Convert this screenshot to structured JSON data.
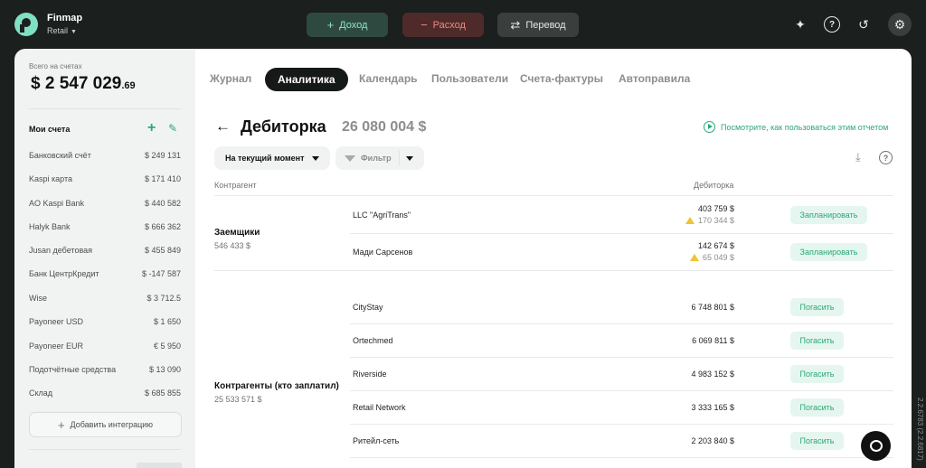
{
  "app": {
    "brand": "Finmap",
    "workspace": "Retail"
  },
  "topbar": {
    "income_label": "Доход",
    "expense_label": "Расход",
    "transfer_label": "Перевод"
  },
  "sidebar": {
    "total_label": "Всего на счетах",
    "total_main": "$ 2 547 029",
    "total_cents": ".69",
    "accounts_title": "Мои счета",
    "accounts": [
      {
        "name": "Банковский счёт",
        "value": "$ 249 131"
      },
      {
        "name": "Kaspi карта",
        "value": "$ 171 410"
      },
      {
        "name": "AO Kaspi Bank",
        "value": "$ 440 582"
      },
      {
        "name": "Halyk Bank",
        "value": "$ 666 362"
      },
      {
        "name": "Jusan дебетовая",
        "value": "$ 455 849"
      },
      {
        "name": "Банк ЦентрКредит",
        "value": "$ -147 587"
      },
      {
        "name": "Wise",
        "value": "$ 3 712.5"
      },
      {
        "name": "Payoneer USD",
        "value": "$ 1 650"
      },
      {
        "name": "Payoneer EUR",
        "value": "€ 5 950"
      },
      {
        "name": "Подотчётные средства",
        "value": "$ 13 090"
      },
      {
        "name": "Склад",
        "value": "$ 685 855"
      }
    ],
    "integration_label": "Добавить интеграцию"
  },
  "tabs": [
    "Журнал",
    "Аналитика",
    "Календарь",
    "Пользователи",
    "Счета-фактуры",
    "Автоправила"
  ],
  "report": {
    "title": "Дебиторка",
    "total": "26 080 004  $",
    "howto_label": "Посмотрите, как пользоваться этим отчетом",
    "period_label": "На текущий момент",
    "filter_label": "Фильтр",
    "col_counterparty": "Контрагент",
    "col_receivable": "Дебиторка",
    "groups": [
      {
        "name": "Заемщики",
        "sum": "546 433  $",
        "rows": [
          {
            "name": "LLC \"AgriTrans\"",
            "amount": "403 759  $",
            "overdue": "170 344  $",
            "action": "Запланировать"
          },
          {
            "name": "Мади Сарсенов",
            "amount": "142 674  $",
            "overdue": "65 049  $",
            "action": "Запланировать"
          }
        ]
      },
      {
        "name": "Контрагенты (кто заплатил)",
        "sum": "25 533 571  $",
        "rows": [
          {
            "name": "CityStay",
            "amount": "6 748 801  $",
            "action": "Погасить"
          },
          {
            "name": "Ortechmed",
            "amount": "6 069 811  $",
            "action": "Погасить"
          },
          {
            "name": "Riverside",
            "amount": "4 983 152  $",
            "action": "Погасить"
          },
          {
            "name": "Retail Network",
            "amount": "3 333 165  $",
            "action": "Погасить"
          },
          {
            "name": "Ритейл-сеть",
            "amount": "2 203 840  $",
            "action": "Погасить"
          }
        ]
      }
    ]
  },
  "version": "2.2.6783 (2.2.6817)"
}
